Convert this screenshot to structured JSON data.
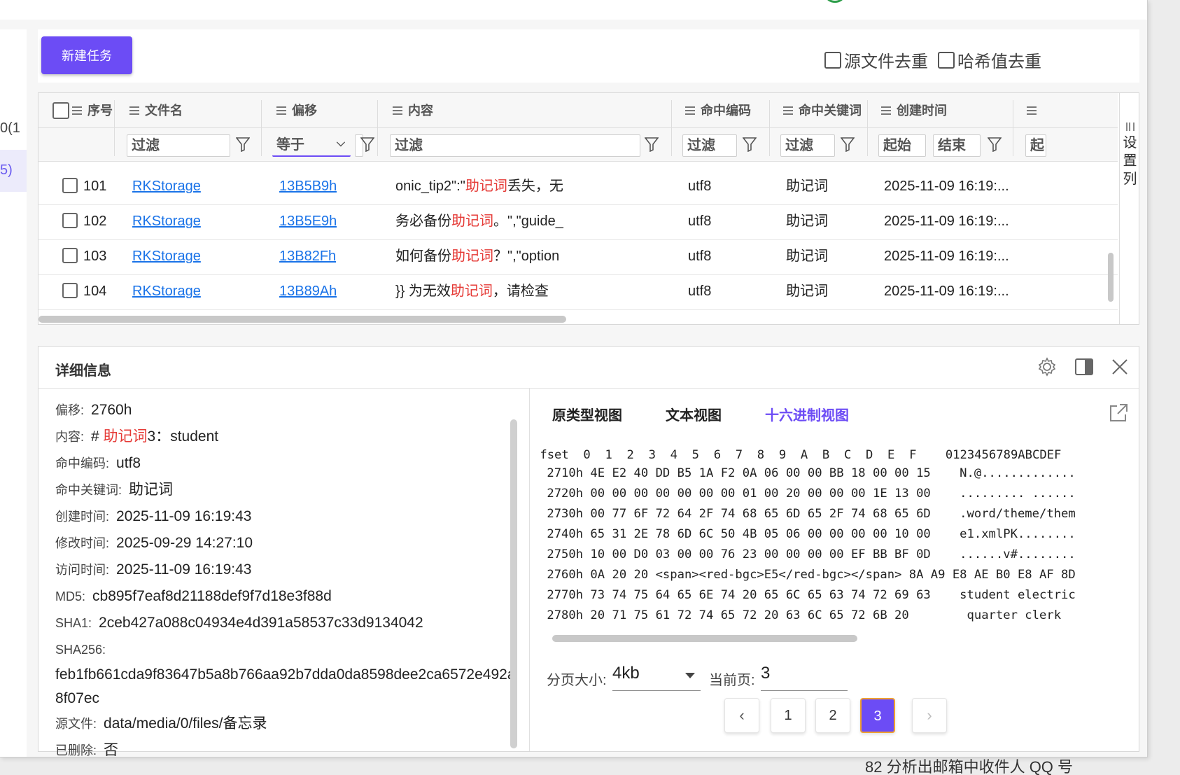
{
  "toolbar": {
    "new_task": "新建任务",
    "dedup_source": "源文件去重",
    "dedup_hash": "哈希值去重"
  },
  "leftnav": {
    "item_a": "0(1",
    "item_b": "5)"
  },
  "grid": {
    "columns": {
      "index": "序号",
      "filename": "文件名",
      "offset": "偏移",
      "content": "内容",
      "encoding": "命中编码",
      "keyword": "命中关键词",
      "created": "创建时间"
    },
    "filters": {
      "placeholder": "过滤",
      "equals": "等于",
      "start": "起始",
      "end": "结束",
      "partial": "起"
    },
    "settings_label": "设置列",
    "rows": [
      {
        "index": "101",
        "file": "RKStorage",
        "offset": "13B5B9h",
        "pre": "onic_tip2\":\"",
        "hit": "助记词",
        "post": "丢失，无",
        "encoding": "utf8",
        "keyword": "助记词",
        "created": "2025-11-09 16:19:..."
      },
      {
        "index": "102",
        "file": "RKStorage",
        "offset": "13B5E9h",
        "pre": "务必备份",
        "hit": "助记词",
        "post": "。\",\"guide_",
        "encoding": "utf8",
        "keyword": "助记词",
        "created": "2025-11-09 16:19:..."
      },
      {
        "index": "103",
        "file": "RKStorage",
        "offset": "13B82Fh",
        "pre": "如何备份",
        "hit": "助记词",
        "post": "？\",\"option",
        "encoding": "utf8",
        "keyword": "助记词",
        "created": "2025-11-09 16:19:..."
      },
      {
        "index": "104",
        "file": "RKStorage",
        "offset": "13B89Ah",
        "pre": "}} 为无效",
        "hit": "助记词",
        "post": "，请检查",
        "encoding": "utf8",
        "keyword": "助记词",
        "created": "2025-11-09 16:19:..."
      }
    ]
  },
  "detail": {
    "title": "详细信息",
    "offset_k": "偏移:",
    "offset_v": "2760h",
    "content_k": "内容:",
    "content_pre": "# ",
    "content_hit": "助记词",
    "content_post": "3：student",
    "encoding_k": "命中编码:",
    "encoding_v": "utf8",
    "keyword_k": "命中关键词:",
    "keyword_v": "助记词",
    "created_k": "创建时间:",
    "created_v": "2025-11-09 16:19:43",
    "modified_k": "修改时间:",
    "modified_v": "2025-09-29 14:27:10",
    "accessed_k": "访问时间:",
    "accessed_v": "2025-11-09 16:19:43",
    "md5_k": "MD5:",
    "md5_v": "cb895f7eaf8d21188def9f7d18e3f88d",
    "sha1_k": "SHA1:",
    "sha1_v": "2ceb427a088c04934e4d391a58537c33d9134042",
    "sha256_k": "SHA256:",
    "sha256_v": "feb1fb661cda9f83647b5a8b766aa92b7dda0da8598dee2ca6572e492a8f07ec",
    "source_k": "源文件:",
    "source_v": "data/media/0/files/备忘录",
    "deleted_k": "已删除:",
    "deleted_v": "否"
  },
  "hexview": {
    "tabs": [
      "原类型视图",
      "文本视图",
      "十六进制视图"
    ],
    "lines": [
      "ffset  0  1  2  3  4  5  6  7  8  9  A  B  C  D  E  F    0123456789ABCDEF",
      " 2710h 4E E2 40 DD B5 1A F2 0A 06 00 00 BB 18 00 00 15    N.@.............",
      " 2720h 00 00 00 00 00 00 00 01 00 20 00 00 00 1E 13 00    ......... ......",
      " 2730h 00 77 6F 72 64 2F 74 68 65 6D 65 2F 74 68 65 6D    .word/theme/them",
      " 2740h 65 31 2E 78 6D 6C 50 4B 05 06 00 00 00 00 10 00    e1.xmlPK........",
      " 2750h 10 00 D0 03 00 00 76 23 00 00 00 00 EF BB BF 0D    ......v#........",
      " 2760h 0A 20 20 <span><red-bgc>E5</red-bgc></span> 8A A9 E8 AE B0 E8 AF 8D",
      " 2770h 73 74 75 64 65 6E 74 20 65 6C 65 63 74 72 69 63    student electric",
      " 2780h 20 71 75 61 72 74 65 72 20 63 6C 65 72 6B 20        quarter clerk"
    ],
    "page_size_label": "分页大小:",
    "page_size_value": "4kb",
    "current_page_label": "当前页:",
    "current_page_value": "3",
    "pages": [
      "1",
      "2",
      "3"
    ],
    "active_page": "3"
  },
  "footer": {
    "text": "82 分析出邮箱中收件人 QQ 号"
  },
  "colors": {
    "accent": "#6c4cf5",
    "link": "#1a73e8",
    "highlight": "#e53935"
  }
}
